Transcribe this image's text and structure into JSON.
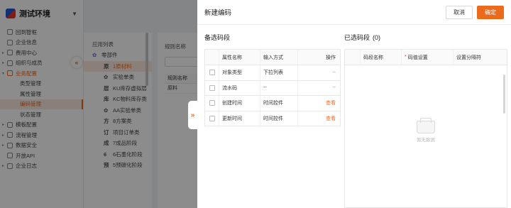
{
  "app": {
    "brand_name": "测试环境",
    "brand_caret": "▼"
  },
  "sidebar": {
    "items": [
      {
        "label": "回到智框",
        "type": "top"
      },
      {
        "label": "企业信息",
        "type": "top"
      },
      {
        "label": "费用中心",
        "type": "group"
      },
      {
        "label": "组织与成员",
        "type": "group"
      },
      {
        "label": "业务配置",
        "type": "group-open"
      },
      {
        "label": "类型管理",
        "type": "sub"
      },
      {
        "label": "属性管理",
        "type": "sub"
      },
      {
        "label": "编码管理",
        "type": "sub-active"
      },
      {
        "label": "状态管理",
        "type": "sub"
      },
      {
        "label": "模板配置",
        "type": "group"
      },
      {
        "label": "流程管理",
        "type": "group"
      },
      {
        "label": "数据安全",
        "type": "group"
      },
      {
        "label": "开放API",
        "type": "top"
      },
      {
        "label": "企业日志",
        "type": "group"
      }
    ],
    "collapse_icon": "«"
  },
  "tree_panel": {
    "title": "应用列表",
    "items": [
      {
        "glyph": "✿",
        "label": "零部件",
        "head": true
      },
      {
        "glyph": "原",
        "label": "1原材料",
        "selected": true
      },
      {
        "glyph": "✿",
        "label": "实验单类"
      },
      {
        "glyph": "层",
        "label": "KU库存虚拟层"
      },
      {
        "glyph": "库",
        "label": "KC物料库存类"
      },
      {
        "glyph": "✿",
        "label": "AA实验单类"
      },
      {
        "glyph": "方",
        "label": "8方案类"
      },
      {
        "glyph": "订",
        "label": "项目订单类"
      },
      {
        "glyph": "成",
        "label": "7成品阶段"
      },
      {
        "glyph": "6",
        "label": "6石墨化阶段"
      },
      {
        "glyph": "预",
        "label": "5预碳化阶段"
      }
    ]
  },
  "rule_panel": {
    "title": "规则名称",
    "col_header": "规则名称",
    "row": "原料"
  },
  "drawer": {
    "title": "新建编码",
    "cancel_label": "取消",
    "confirm_label": "确定",
    "handle_icon": "»",
    "left": {
      "title": "备选码段",
      "headers": [
        "属性名称",
        "输入方式",
        "操作"
      ],
      "rows": [
        {
          "name": "对象类型",
          "input": "下拉列表",
          "op": "--",
          "op_link": false
        },
        {
          "name": "流水码",
          "input": "--",
          "op": "--",
          "op_link": false
        },
        {
          "name": "创建时间",
          "input": "时间控件",
          "op": "查看",
          "op_link": true
        },
        {
          "name": "更新时间",
          "input": "时间控件",
          "op": "查看",
          "op_link": true
        }
      ]
    },
    "right": {
      "title": "已选码段",
      "count": "(0)",
      "headers": [
        "码段名称",
        "码值设置",
        "设置分隔符"
      ],
      "required_mark": "*",
      "empty_text": "暂无数据"
    }
  },
  "colors": {
    "accent": "#ec6a1c",
    "brand_blue": "#1d5ad8",
    "brand_red": "#e9342a"
  }
}
